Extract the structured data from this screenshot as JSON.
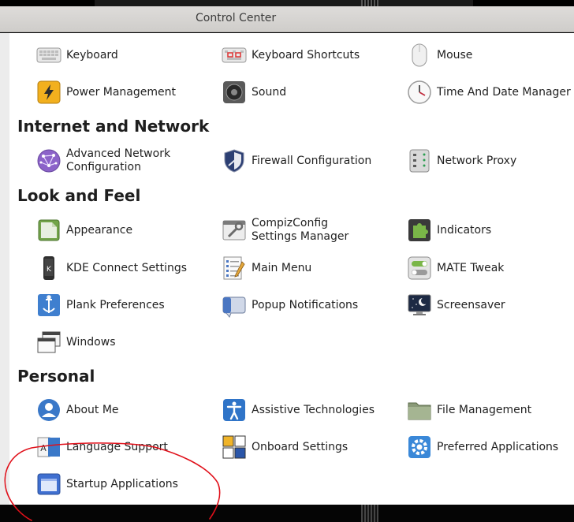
{
  "window": {
    "title": "Control Center"
  },
  "sections": {
    "hardware_cont": {
      "items": [
        {
          "label": "Keyboard",
          "icon": "keyboard-icon"
        },
        {
          "label": "Keyboard Shortcuts",
          "icon": "keyboard-shortcuts-icon"
        },
        {
          "label": "Mouse",
          "icon": "mouse-icon"
        },
        {
          "label": "Power Management",
          "icon": "power-management-icon"
        },
        {
          "label": "Sound",
          "icon": "sound-icon"
        },
        {
          "label": "Time And Date Manager",
          "icon": "clock-icon"
        }
      ]
    },
    "internet": {
      "title": "Internet and Network",
      "items": [
        {
          "label": "Advanced Network Configuration",
          "icon": "network-icon"
        },
        {
          "label": "Firewall Configuration",
          "icon": "firewall-shield-icon"
        },
        {
          "label": "Network Proxy",
          "icon": "network-proxy-icon"
        }
      ]
    },
    "look": {
      "title": "Look and Feel",
      "items": [
        {
          "label": "Appearance",
          "icon": "appearance-icon"
        },
        {
          "label": "CompizConfig Settings Manager",
          "icon": "compiz-icon"
        },
        {
          "label": "Indicators",
          "icon": "indicators-puzzle-icon"
        },
        {
          "label": "KDE Connect Settings",
          "icon": "kde-connect-icon"
        },
        {
          "label": "Main Menu",
          "icon": "main-menu-icon"
        },
        {
          "label": "MATE Tweak",
          "icon": "mate-tweak-icon"
        },
        {
          "label": "Plank Preferences",
          "icon": "plank-icon"
        },
        {
          "label": "Popup Notifications",
          "icon": "popup-notifications-icon"
        },
        {
          "label": "Screensaver",
          "icon": "screensaver-icon"
        },
        {
          "label": "Windows",
          "icon": "windows-icon"
        }
      ]
    },
    "personal": {
      "title": "Personal",
      "items": [
        {
          "label": "About Me",
          "icon": "about-me-icon"
        },
        {
          "label": "Assistive Technologies",
          "icon": "accessibility-icon"
        },
        {
          "label": "File Management",
          "icon": "file-management-icon"
        },
        {
          "label": "Language Support",
          "icon": "language-support-icon"
        },
        {
          "label": "Onboard Settings",
          "icon": "onboard-keyboard-icon"
        },
        {
          "label": "Preferred Applications",
          "icon": "preferred-apps-gear-icon"
        },
        {
          "label": "Startup Applications",
          "icon": "startup-applications-icon"
        }
      ]
    }
  },
  "colors": {
    "annotation": "#e0101a",
    "accent_blue": "#3a6ec4"
  }
}
